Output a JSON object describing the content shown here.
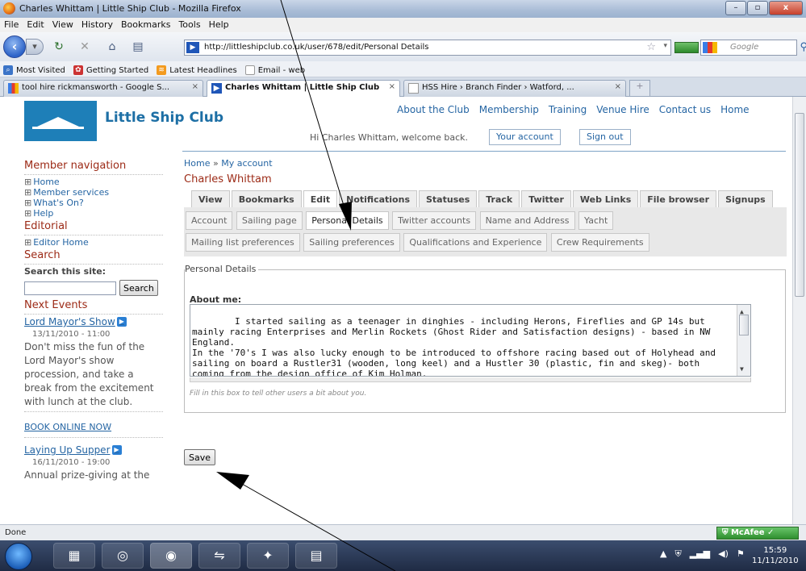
{
  "window": {
    "title": "Charles Whittam | Little Ship Club - Mozilla Firefox",
    "controls": [
      "–",
      "▫",
      "x"
    ]
  },
  "menu": [
    "File",
    "Edit",
    "View",
    "History",
    "Bookmarks",
    "Tools",
    "Help"
  ],
  "navbar": {
    "url": "http://littleshipclub.co.uk/user/678/edit/Personal Details",
    "search_placeholder": "Google"
  },
  "bookmarks": [
    "Most Visited",
    "Getting Started",
    "Latest Headlines",
    "Email - web"
  ],
  "browser_tabs": [
    {
      "label": "tool hire rickmansworth - Google S...",
      "active": false
    },
    {
      "label": "Charles Whittam | Little Ship Club",
      "active": true
    },
    {
      "label": "HSS Hire › Branch Finder › Watford, ...",
      "active": false
    }
  ],
  "site": {
    "name": "Little Ship Club",
    "topnav": [
      "About the Club",
      "Membership",
      "Training",
      "Venue Hire",
      "Contact us",
      "Home"
    ],
    "welcome": "Hi Charles Whittam, welcome back.",
    "your_account": "Your account",
    "sign_out": "Sign out"
  },
  "sidebar": {
    "member_nav_heading": "Member navigation",
    "member_items": [
      "Home",
      "Member services",
      "What's On?",
      "Help"
    ],
    "editorial_heading": "Editorial",
    "editorial_items": [
      "Editor Home"
    ],
    "search_heading": "Search",
    "search_label": "Search this site:",
    "search_button": "Search",
    "events_heading": "Next Events",
    "events": [
      {
        "title": "Lord Mayor's Show",
        "date": "13/11/2010 - 11:00",
        "desc": "Don't miss the fun of the Lord Mayor's show procession, and take a break from the excitement with lunch at the club.",
        "link": "BOOK ONLINE NOW"
      },
      {
        "title": "Laying Up Supper",
        "date": "16/11/2010 - 19:00",
        "desc": "Annual prize-giving at the"
      }
    ]
  },
  "main": {
    "breadcrumb_home": "Home",
    "breadcrumb_sep": " » ",
    "breadcrumb_current": "My account",
    "title": "Charles Whittam",
    "tabs": [
      "View",
      "Bookmarks",
      "Edit",
      "Notifications",
      "Statuses",
      "Track",
      "Twitter",
      "Web Links",
      "File browser",
      "Signups"
    ],
    "subtabs_row1": [
      "Account",
      "Sailing page",
      "Personal Details",
      "Twitter accounts",
      "Name and Address",
      "Yacht"
    ],
    "subtabs_row2": [
      "Mailing list preferences",
      "Sailing preferences",
      "Qualifications and Experience",
      "Crew Requirements"
    ],
    "legend": "Personal Details",
    "about_label": "About me:",
    "about_text": "I started sailing as a teenager in dinghies - including Herons, Fireflies and GP 14s but mainly racing Enterprises and Merlin Rockets (Ghost Rider and Satisfaction designs) - based in NW England.\nIn the '70's I was also lucky enough to be introduced to offshore racing based out of Holyhead and sailing on board a Rustler31 (wooden, long keel) and a Hustler 30 (plastic, fin and skeg)- both coming from the design office of Kim Holman.",
    "help_text": "Fill in this box to tell other users a bit about you.",
    "save": "Save"
  },
  "status": {
    "text": "Done",
    "mcafee": "McAfee"
  },
  "taskbar": {
    "time": "15:59",
    "date": "11/11/2010"
  }
}
